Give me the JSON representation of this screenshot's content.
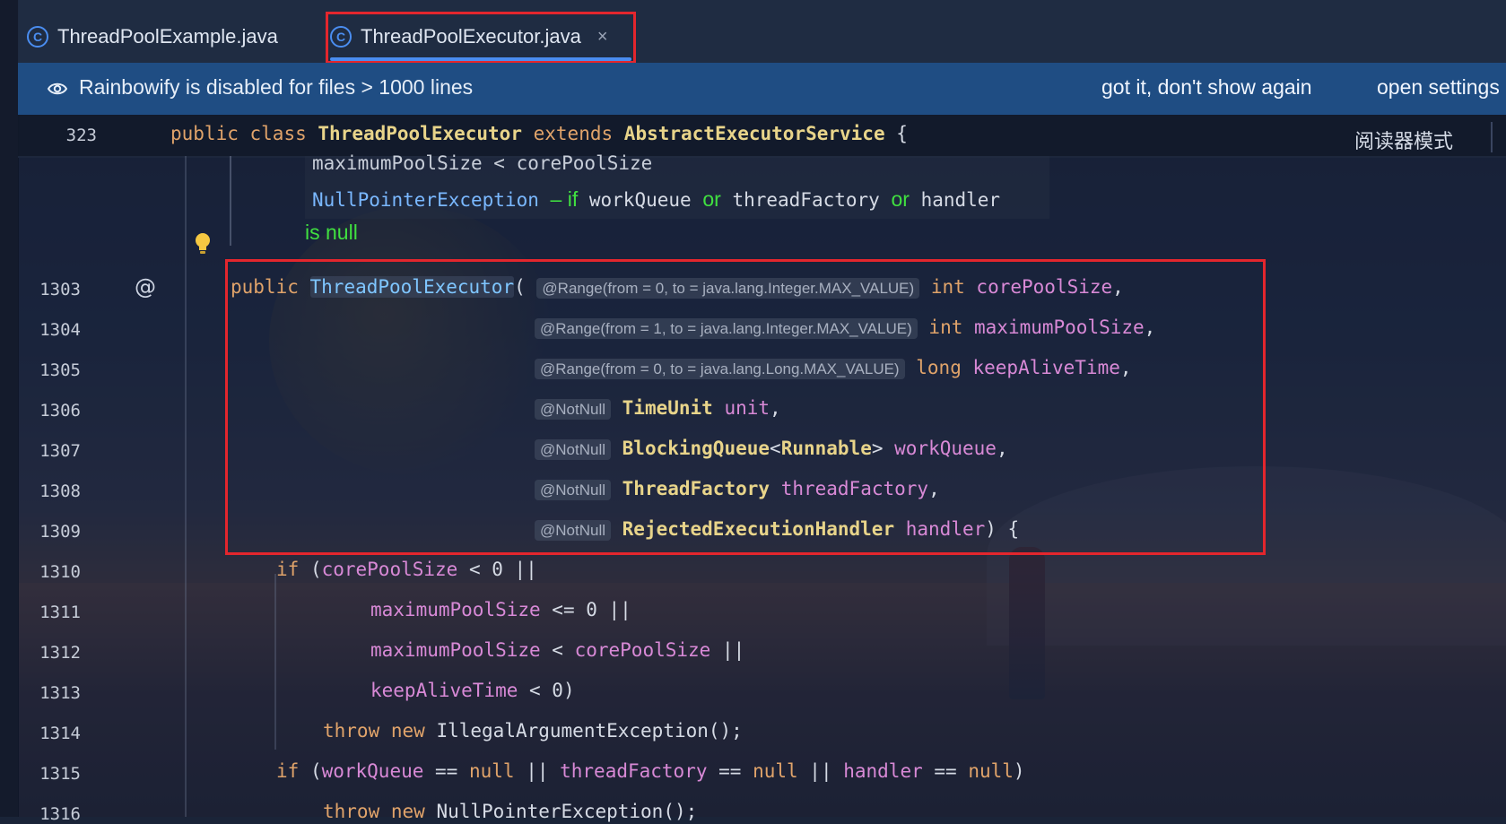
{
  "tabs": [
    {
      "label": "ThreadPoolExample.java",
      "icon": "java-class-icon",
      "active": false
    },
    {
      "label": "ThreadPoolExecutor.java",
      "icon": "java-class-icon",
      "active": true,
      "close": "×"
    }
  ],
  "banner": {
    "message": "Rainbowify is disabled for files > 1000 lines",
    "got_it": "got it, don't show again",
    "open_settings": "open settings"
  },
  "reader_mode": "阅读器模式",
  "sticky": {
    "line": "323",
    "kw_public": "public",
    "kw_class": "class",
    "class_name": "ThreadPoolExecutor",
    "kw_extends": "extends",
    "super_name": "AbstractExecutorService",
    "brace": "{"
  },
  "doc": {
    "line1": "maximumPoolSize < corePoolSize",
    "exception": "NullPointerException",
    "dash_if": "– if",
    "workQueue": "workQueue",
    "or1": "or",
    "threadFactory": "threadFactory",
    "or2": "or",
    "handler": "handler",
    "is_null": "is null"
  },
  "lines": {
    "1303": {
      "num": "1303",
      "kw": "public",
      "fn": "ThreadPoolExecutor",
      "paren": "(",
      "hint": "@Range(from = 0, to = java.lang.Integer.MAX_VALUE)",
      "type": "int",
      "var": "corePoolSize",
      "comma": ","
    },
    "1304": {
      "num": "1304",
      "hint": "@Range(from = 1, to = java.lang.Integer.MAX_VALUE)",
      "type": "int",
      "var": "maximumPoolSize",
      "comma": ","
    },
    "1305": {
      "num": "1305",
      "hint": "@Range(from = 0, to = java.lang.Long.MAX_VALUE)",
      "type": "long",
      "var": "keepAliveTime",
      "comma": ","
    },
    "1306": {
      "num": "1306",
      "hint": "@NotNull",
      "type": "TimeUnit",
      "var": "unit",
      "comma": ","
    },
    "1307": {
      "num": "1307",
      "hint": "@NotNull",
      "type": "BlockingQueue",
      "lt": "<",
      "generic": "Runnable",
      "gt": ">",
      "var": "workQueue",
      "comma": ","
    },
    "1308": {
      "num": "1308",
      "hint": "@NotNull",
      "type": "ThreadFactory",
      "var": "threadFactory",
      "comma": ","
    },
    "1309": {
      "num": "1309",
      "hint": "@NotNull",
      "type": "RejectedExecutionHandler",
      "var": "handler",
      "end": ") {"
    },
    "1310": {
      "num": "1310",
      "kw": "if",
      "open": " (",
      "var": "corePoolSize",
      "rest": " < 0 ||"
    },
    "1311": {
      "num": "1311",
      "var": "maximumPoolSize",
      "rest": " <= 0 ||"
    },
    "1312": {
      "num": "1312",
      "var": "maximumPoolSize",
      "mid": " < ",
      "var2": "corePoolSize",
      "rest": " ||"
    },
    "1313": {
      "num": "1313",
      "var": "keepAliveTime",
      "rest": " < 0)"
    },
    "1314": {
      "num": "1314",
      "kw1": "throw",
      "kw2": "new",
      "rest": " IllegalArgumentException();"
    },
    "1315": {
      "num": "1315",
      "kw": "if",
      "open": " (",
      "v1": "workQueue",
      "eq1": " == ",
      "n1": "null",
      "or1": " || ",
      "v2": "threadFactory",
      "eq2": " == ",
      "n2": "null",
      "or2": " || ",
      "v3": "handler",
      "eq3": " == ",
      "n3": "null",
      "close": ")"
    },
    "1316": {
      "num": "1316",
      "kw1": "throw",
      "kw2": "new",
      "rest": " NullPointerException();"
    }
  },
  "colors": {
    "accent": "#4a8df0",
    "highlight_frame": "#e3262d",
    "banner": "#1f4d83",
    "hint_green": "#40e040"
  }
}
